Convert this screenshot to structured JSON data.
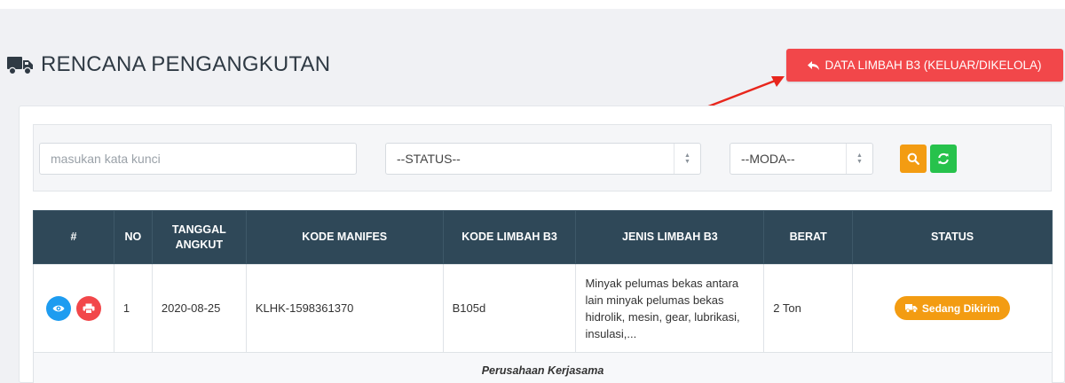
{
  "header": {
    "title": "RENCANA PENGANGKUTAN",
    "back_button_label": "DATA LIMBAH B3 (KELUAR/DIKELOLA)"
  },
  "filters": {
    "keyword_placeholder": "masukan kata kunci",
    "status_selected": "--STATUS--",
    "moda_selected": "--MODA--"
  },
  "table": {
    "columns": [
      "#",
      "NO",
      "TANGGAL ANGKUT",
      "KODE MANIFES",
      "KODE LIMBAH B3",
      "JENIS LIMBAH B3",
      "BERAT",
      "STATUS"
    ],
    "rows": [
      {
        "no": "1",
        "tanggal_angkut": "2020-08-25",
        "kode_manifes": "KLHK-1598361370",
        "kode_limbah": "B105d",
        "jenis_limbah": "Minyak pelumas bekas antara lain minyak pelumas bekas hidrolik, mesin, gear, lubrikasi, insulasi,...",
        "berat": "2 Ton",
        "status": "Sedang Dikirim"
      }
    ],
    "sub_row_label": "Perusahaan Kerjasama"
  },
  "icons": {
    "title_icon": "truck-icon",
    "back_icon": "reply-icon",
    "search_icon": "search-icon",
    "refresh_icon": "refresh-icon",
    "view_icon": "eye-icon",
    "print_icon": "print-icon",
    "status_icon": "truck-icon"
  },
  "colors": {
    "header_bg": "#2f4858",
    "danger": "#f2474a",
    "warning": "#f39c12",
    "success": "#27c24c",
    "info": "#1e9cf0"
  }
}
